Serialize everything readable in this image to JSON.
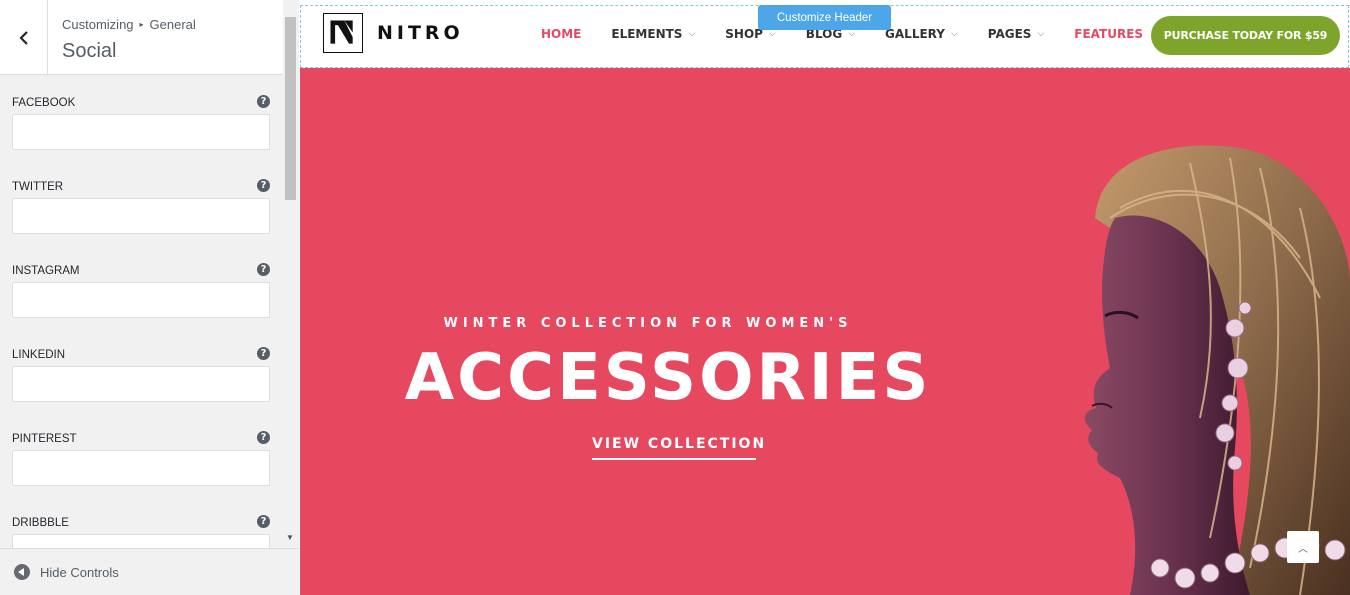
{
  "sidebar": {
    "breadcrumb": {
      "parent": "Customizing",
      "separator": "▸",
      "section": "General"
    },
    "title": "Social",
    "fields": [
      {
        "label": "FACEBOOK",
        "value": ""
      },
      {
        "label": "TWITTER",
        "value": ""
      },
      {
        "label": "INSTAGRAM",
        "value": ""
      },
      {
        "label": "LINKEDIN",
        "value": ""
      },
      {
        "label": "PINTEREST",
        "value": ""
      },
      {
        "label": "DRIBBBLE",
        "value": ""
      }
    ],
    "help_glyph": "?",
    "footer_label": "Hide Controls"
  },
  "preview": {
    "customize_tag": "Customize Header",
    "logo_text": "NITRO",
    "nav": [
      {
        "label": "HOME",
        "dropdown": false,
        "active": true
      },
      {
        "label": "ELEMENTS",
        "dropdown": true
      },
      {
        "label": "SHOP",
        "dropdown": true
      },
      {
        "label": "BLOG",
        "dropdown": true
      },
      {
        "label": "GALLERY",
        "dropdown": true
      },
      {
        "label": "PAGES",
        "dropdown": true
      },
      {
        "label": "FEATURES",
        "dropdown": false,
        "highlight": true
      }
    ],
    "purchase_button": "PURCHASE TODAY FOR $59",
    "hero": {
      "subtitle": "WINTER COLLECTION FOR WOMEN'S",
      "title": "ACCESSORIES",
      "link": "VIEW COLLECTION"
    }
  },
  "colors": {
    "hero_bg": "#e5485f",
    "accent_pink": "#e34b65",
    "purchase_green": "#7fa42c",
    "customize_tag_blue": "#4ca6e8"
  },
  "icons": {
    "back": "chevron-left-icon",
    "help": "question-circle-icon",
    "collapse": "collapse-left-icon",
    "dropdown": "chevron-down-icon",
    "scroll_top": "chevron-up-icon"
  }
}
